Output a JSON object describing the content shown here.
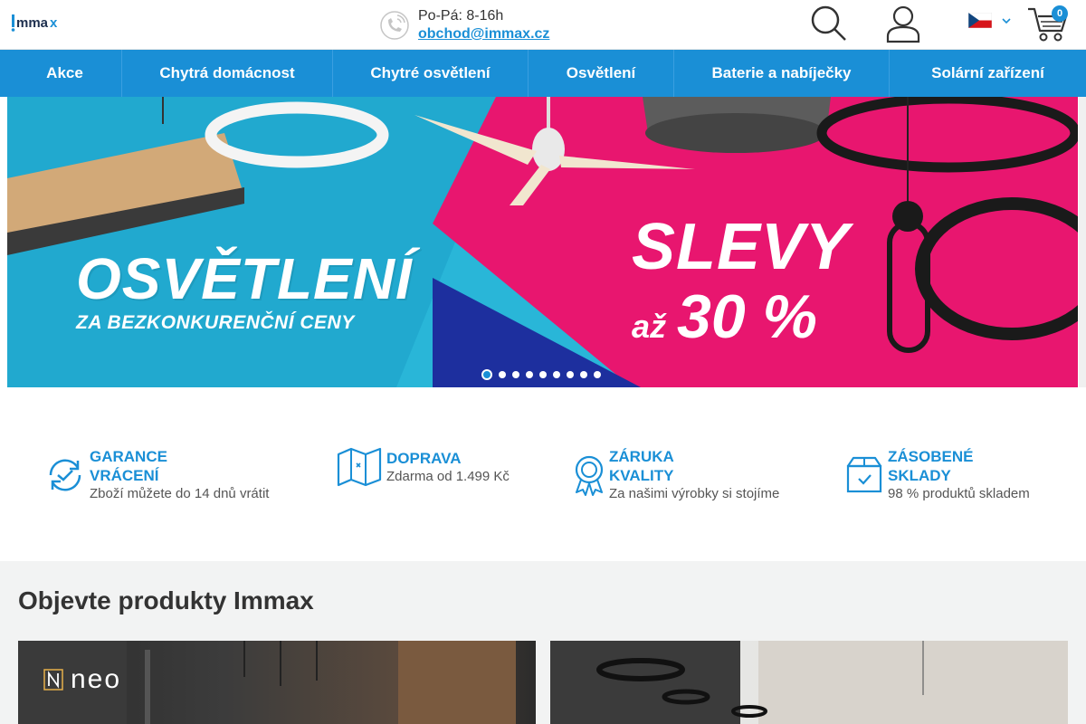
{
  "header": {
    "logo_text": "Immax",
    "hours": "Po-Pá: 8-16h",
    "email": "obchod@immax.cz",
    "cart_count": "0",
    "icons": [
      "phone-icon",
      "search-icon",
      "user-icon",
      "flag-cz-icon",
      "chevron-down-icon",
      "cart-icon"
    ]
  },
  "nav": {
    "items": [
      "Akce",
      "Chytrá domácnost",
      "Chytré osvětlení",
      "Osvětlení",
      "Baterie a nabíječky",
      "Solární zařízení"
    ]
  },
  "hero": {
    "headline": "OSVĚTLENÍ",
    "subline": "ZA BEZKONKURENČNÍ CENY",
    "sale": "SLEVY",
    "sale_prefix": "až",
    "sale_value": "30 %",
    "slides_total": 9,
    "active_slide": 1
  },
  "benefits": [
    {
      "title_1": "GARANCE",
      "title_2": "VRÁCENÍ",
      "text": "Zboží můžete do 14 dnů vrátit",
      "icon": "refresh-icon"
    },
    {
      "title_1": "DOPRAVA",
      "title_2": "",
      "text": "Zdarma od 1.499 Kč",
      "icon": "map-icon"
    },
    {
      "title_1": "ZÁRUKA",
      "title_2": "KVALITY",
      "text": "Za našimi výrobky si stojíme",
      "icon": "award-icon"
    },
    {
      "title_1": "ZÁSOBENÉ",
      "title_2": "SKLADY",
      "text": "98 % produktů skladem",
      "icon": "box-check-icon"
    }
  ],
  "products": {
    "heading": "Objevte produkty Immax",
    "card1_brand": "neo"
  },
  "colors": {
    "accent": "#1a8fd6",
    "hero_pink": "#e8166f",
    "hero_cyan": "#29b6d8",
    "hero_navy": "#1d2f9e"
  }
}
